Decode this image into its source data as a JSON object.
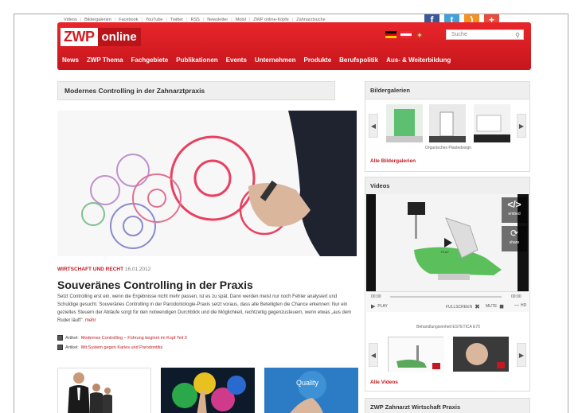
{
  "toplinks": [
    "Videos",
    "Bildergalerien",
    "Facebook",
    "YouTube",
    "Twitter",
    "RSS",
    "Newsletter",
    "Mobil",
    "ZWP online-Köpfe",
    "Zahnarztsuche"
  ],
  "social": [
    {
      "name": "facebook-icon",
      "glyph": "f",
      "color": "#3b5998"
    },
    {
      "name": "twitter-icon",
      "glyph": "t",
      "color": "#41a1d9"
    },
    {
      "name": "rss-icon",
      "glyph": ")",
      "color": "#f39124"
    },
    {
      "name": "plus-icon",
      "glyph": "+",
      "color": "#e74c3c"
    }
  ],
  "logo": {
    "zwp": "ZWP",
    "online": "online"
  },
  "search": {
    "placeholder": "Suche"
  },
  "nav": [
    "News",
    "ZWP Thema",
    "Fachgebiete",
    "Publikationen",
    "Events",
    "Unternehmen",
    "Produkte",
    "Berufspolitik",
    "Aus- & Weiterbildung"
  ],
  "main": {
    "page_title": "Modernes Controlling in der Zahnarztpraxis",
    "category": "WIRTSCHAFT UND RECHT",
    "date": "16.01.2012",
    "headline": "Souveränes Controlling in der Praxis",
    "teaser": "Setzt Controlling erst ein, wenn die Ergebnisse nicht mehr passen, ist es zu spät. Dann werden meist nur noch Fehler analysiert und Schuldige gesucht. Souveränes Controlling in der Parodontologie-Praxis setzt voraus, dass alle Beteiligten die Chance erkennen: Nur ein gezieltes Steuern der Abläufe sorgt für den notwendigen Durchblick und die Möglichkeit, rechtzeitig gegenzusteuern, wenn etwas „aus dem Ruder läuft\".",
    "more": "mehr",
    "articles": [
      {
        "prefix": "Artikel:",
        "title": "Modernes Controlling – Führung beginnt im Kopf Teil 3"
      },
      {
        "prefix": "Artikel:",
        "title": "Mit System gegen Karies und Parodontitis"
      }
    ],
    "quality_label": "Quality"
  },
  "sidebar": {
    "gallery": {
      "title": "Bildergalerien",
      "caption": "Organisches Plastedesign",
      "link": "Alle Bildergalerien"
    },
    "videos": {
      "title": "Videos",
      "embed": "embed",
      "share": "share",
      "play_overlay": "PLAY",
      "time_left": "00:00",
      "time_right": "00:00",
      "play": "PLAY",
      "fullscreen": "FULLSCREEN",
      "mute": "MUTE",
      "hd": "HD",
      "caption": "Behandlungseinheit ESTETICA E70",
      "link": "Alle Videos"
    },
    "wirtschaft": {
      "title": "ZWP Zahnarzt Wirtschaft Praxis"
    }
  }
}
